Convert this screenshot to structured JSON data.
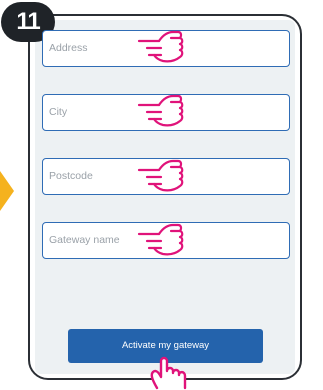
{
  "step": {
    "number": "11"
  },
  "form": {
    "fields": [
      {
        "placeholder": "Address"
      },
      {
        "placeholder": "City"
      },
      {
        "placeholder": "Postcode"
      },
      {
        "placeholder": "Gateway name"
      }
    ],
    "submit_label": "Activate my gateway"
  },
  "colors": {
    "accent": "#2463ac",
    "field_border": "#2f6cb5",
    "pointer_hand": "#e0137a",
    "badge": "#1f2328",
    "screen_background": "#edf1f3",
    "side_arrow": "#f5b21e"
  },
  "icons": {
    "field_pointer": "pointing-hand-icon",
    "button_pointer": "click-hand-icon",
    "side": "arrow-right-icon"
  }
}
